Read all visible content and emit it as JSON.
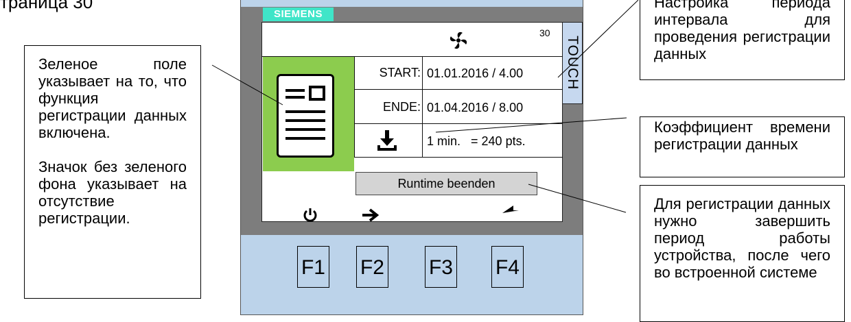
{
  "page_title": "траница 30",
  "callouts": {
    "left_p1": "Зеленое поле указывает на то, что функция регистрации данных включена.",
    "left_p2": "Значок без зеленого фона указывает на отсутствие регистрации.",
    "top_right": "Настройка периода интервала для проведения регистрации данных",
    "mid_right": "Коэффициент времени регистрации данных",
    "bottom_right": "Для регистрации данных нужно завершить период работы устройства, после чего во встроенной системе"
  },
  "device": {
    "brand": "SIEMENS",
    "touch_label": "TOUCH",
    "page_number": "30",
    "start_label": "START:",
    "start_value": "01.01.2016 / 4.00",
    "end_label": "ENDE:",
    "end_value": "01.04.2016 / 8.00",
    "rate_value": "1 min.   = 240 pts.",
    "runtime_button": "Runtime beenden",
    "function_keys": [
      "F1",
      "F2",
      "F3",
      "F4"
    ]
  },
  "icons": [
    "fan-icon",
    "document-icon",
    "download-icon",
    "power-icon",
    "arrow-right-icon",
    "back-arrow-icon"
  ],
  "colors": {
    "device_body": "#bcd3ea",
    "bezel": "#7d7d7d",
    "siemens_tab": "#3fe5c8",
    "active_panel": "#8ccc4e",
    "button": "#d4d4d4"
  }
}
